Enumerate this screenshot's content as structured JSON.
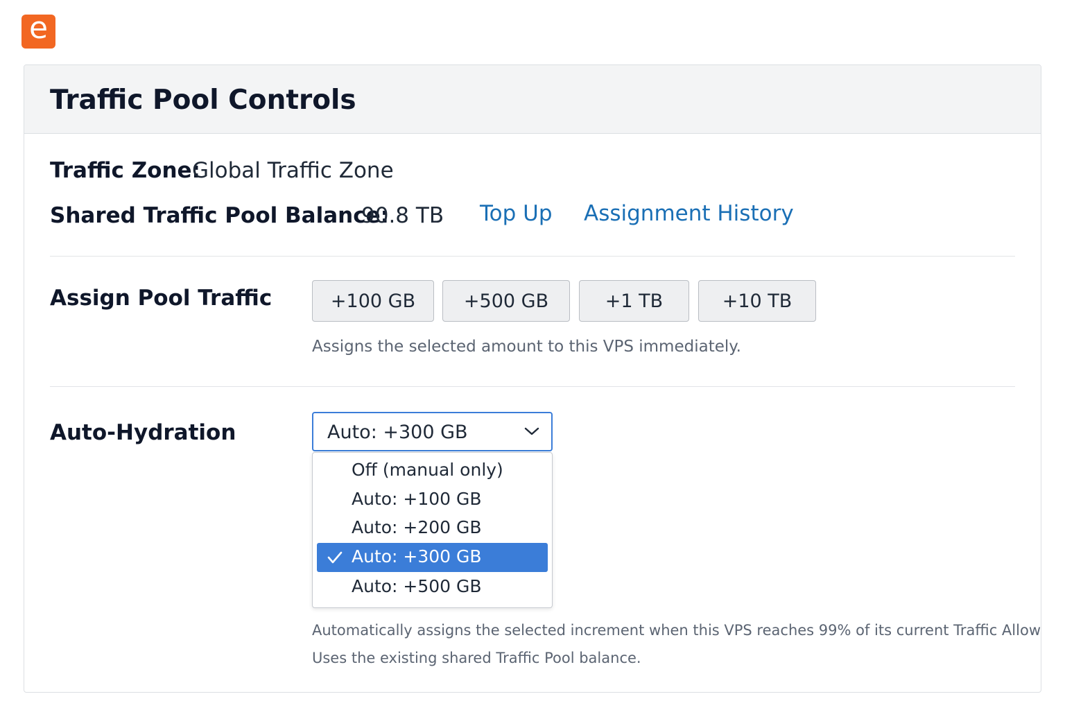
{
  "logo": {
    "letter": "e",
    "icon": "e-logo-icon",
    "color": "#f26722"
  },
  "panel": {
    "title": "Traffic Pool Controls"
  },
  "traffic_zone": {
    "label": "Traffic Zone:",
    "value": "Global Traffic Zone"
  },
  "pool_balance": {
    "label": "Shared Traffic Pool Balance:",
    "value": "90.8 TB"
  },
  "links": {
    "top_up": "Top Up",
    "assignment_history": "Assignment History",
    "color": "#1a6fb5"
  },
  "assign": {
    "label": "Assign Pool Traffic",
    "buttons": [
      "+100 GB",
      "+500 GB",
      "+1 TB",
      "+10 TB"
    ],
    "help": "Assigns the selected amount to this VPS immediately."
  },
  "auto_hydration": {
    "label": "Auto-Hydration",
    "selected_value": "Auto: +300 GB",
    "options": [
      {
        "label": "Off (manual only)",
        "selected": false
      },
      {
        "label": "Auto: +100 GB",
        "selected": false
      },
      {
        "label": "Auto: +200 GB",
        "selected": false
      },
      {
        "label": "Auto: +300 GB",
        "selected": true
      },
      {
        "label": "Auto: +500 GB",
        "selected": false
      }
    ],
    "help_line1": "Automatically assigns the selected increment when this VPS reaches 99% of its current Traffic Allowance.",
    "help_line2": "Uses the existing shared Traffic Pool balance.",
    "accent": "#3b7dd8"
  }
}
